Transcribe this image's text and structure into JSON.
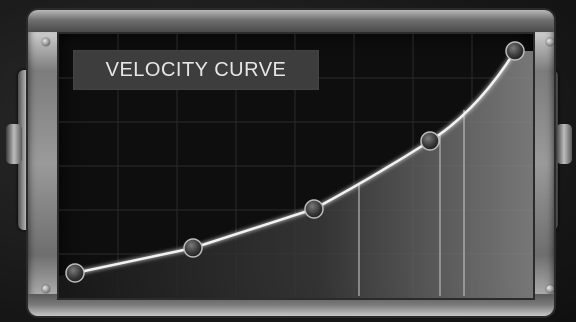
{
  "panel": {
    "title": "VELOCITY CURVE"
  },
  "colors": {
    "screen_background": "#0e0e0e",
    "grid_line": "#2a2a2a",
    "curve_line": "#f2f2f2",
    "title_box_background": "#3d3d3d",
    "title_text": "#e6e6e6",
    "frame_metal": "#9a9a9a"
  },
  "icons": [
    "screw-icon",
    "side-clamp",
    "side-knob"
  ]
}
